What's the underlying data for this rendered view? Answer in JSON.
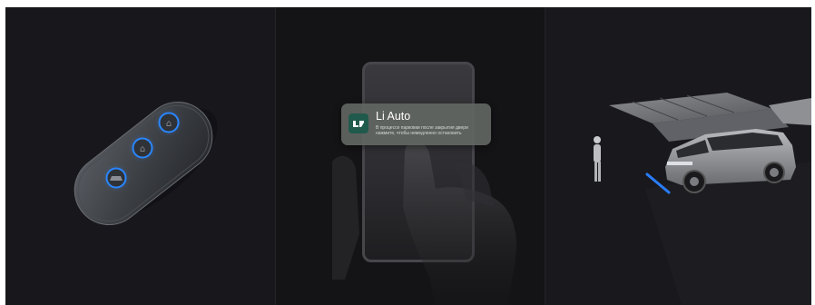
{
  "notification": {
    "app_name": "Li Auto",
    "message": "В процессе парковки после закрытия двери нажмите, чтобы немедленно остановить",
    "icon": "li-auto-logo-icon",
    "icon_color": "#1f5a4c"
  },
  "panels": [
    {
      "subject": "key-fob",
      "accent_color": "#2a86ff"
    },
    {
      "subject": "phone-notification"
    },
    {
      "subject": "parking-scene",
      "accent_color": "#2a7cff"
    }
  ],
  "key_fob": {
    "buttons": [
      "unlock-icon",
      "lock-icon",
      "car-icon"
    ]
  }
}
